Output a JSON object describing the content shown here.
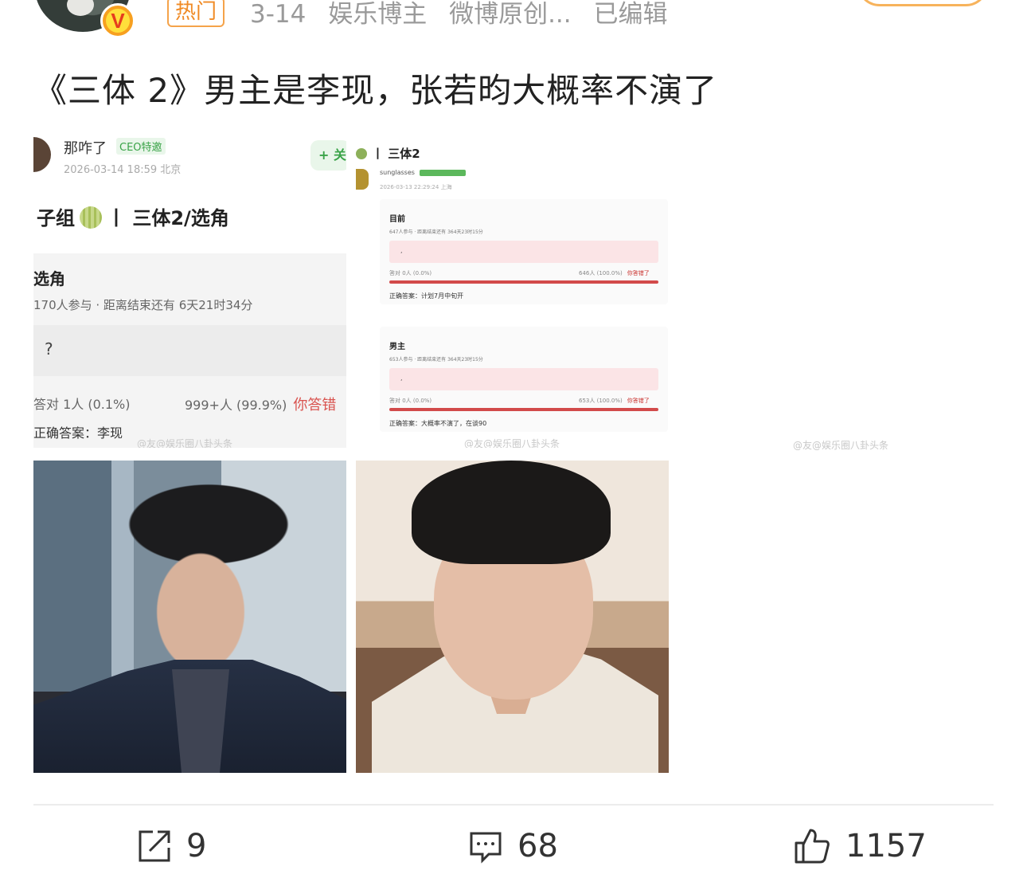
{
  "header": {
    "hot_tag": "热门",
    "date": "3-14",
    "author_title": "娱乐博主",
    "source": "微博原创...",
    "edited": "已编辑",
    "verified_badge": "V"
  },
  "post": {
    "text": "《三体 2》男主是李现，张若昀大概率不演了"
  },
  "screenshot1": {
    "username": "那咋了",
    "badge": "CEO特邀",
    "datetime": "2026-03-14 18:59 北京",
    "follow": "+ 关",
    "topic_prefix": "子组",
    "topic_suffix": "丨 三体2/选角",
    "poll_title": "选角",
    "participants": "170人参与 · 距离结束还有 6天21时34分",
    "option": "?",
    "stat_left": "答对 1人 (0.1%)",
    "stat_right": "999+人 (99.9%)",
    "wrong_label": "你答错",
    "answer": "正确答案：李现",
    "watermark": "@友@娱乐圈八卦头条"
  },
  "screenshot2": {
    "topic": "丨 三体2",
    "username": "sunglasses",
    "datetime": "2026-03-13 22:29:24 上海",
    "polls": [
      {
        "title": "目前",
        "participants": "647人参与 · 距离结束还有 364天23时15分",
        "option": ",",
        "stat_left": "答对 0人 (0.0%)",
        "stat_right": "646人 (100.0%)",
        "wrong_label": "你答错了",
        "answer": "正确答案：计划7月中旬开"
      },
      {
        "title": "男主",
        "participants": "653人参与 · 距离结束还有 364天23时15分",
        "option": ",",
        "stat_left": "答对 0人 (0.0%)",
        "stat_right": "653人 (100.0%)",
        "wrong_label": "你答错了",
        "answer": "正确答案：大概率不演了，在谈90"
      }
    ],
    "watermark": "@友@娱乐圈八卦头条"
  },
  "image3_watermark": "@友@娱乐圈八卦头条",
  "actions": {
    "share_count": "9",
    "comment_count": "68",
    "like_count": "1157"
  },
  "icons": [
    "verified-v-icon",
    "share-icon",
    "comment-icon",
    "like-icon"
  ],
  "colors": {
    "accent_orange": "#f08a24",
    "wrong_red": "#d9534f",
    "green": "#3aa348"
  }
}
